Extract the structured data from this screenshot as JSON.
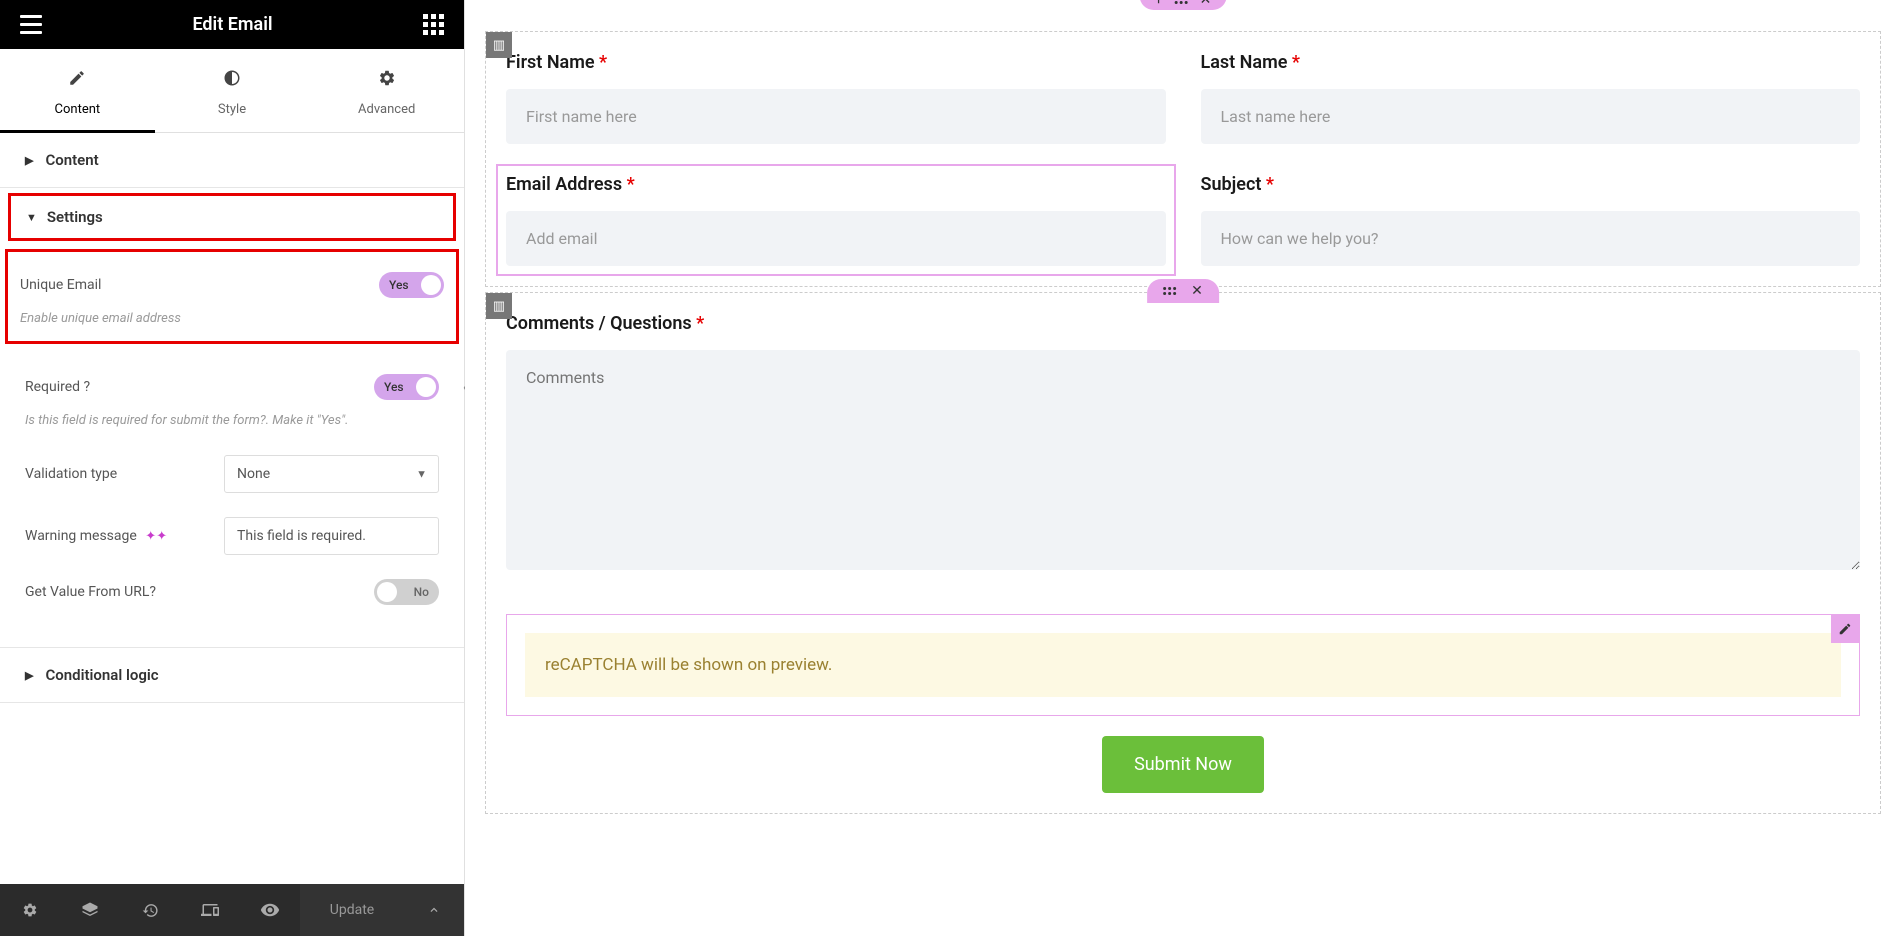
{
  "sidebar": {
    "title": "Edit Email",
    "tabs": {
      "content": "Content",
      "style": "Style",
      "advanced": "Advanced"
    },
    "sections": {
      "content": "Content",
      "settings": "Settings",
      "conditional_logic": "Conditional logic"
    },
    "settings": {
      "unique_email": {
        "label": "Unique Email",
        "description": "Enable unique email address",
        "toggle_text": "Yes"
      },
      "required": {
        "label": "Required ?",
        "description": "Is this field is required for submit the form?. Make it \"Yes\".",
        "toggle_text": "Yes"
      },
      "validation_type": {
        "label": "Validation type",
        "value": "None"
      },
      "warning_message": {
        "label": "Warning message",
        "value": "This field is required."
      },
      "get_value_url": {
        "label": "Get Value From URL?",
        "toggle_text": "No"
      }
    },
    "footer": {
      "update": "Update"
    }
  },
  "form": {
    "first_name": {
      "label": "First Name",
      "placeholder": "First name here"
    },
    "last_name": {
      "label": "Last Name",
      "placeholder": "Last name here"
    },
    "email": {
      "label": "Email Address",
      "placeholder": "Add email"
    },
    "subject": {
      "label": "Subject",
      "placeholder": "How can we help you?"
    },
    "comments": {
      "label": "Comments / Questions",
      "placeholder": "Comments"
    },
    "recaptcha_notice": "reCAPTCHA will be shown on preview.",
    "submit": "Submit Now"
  }
}
